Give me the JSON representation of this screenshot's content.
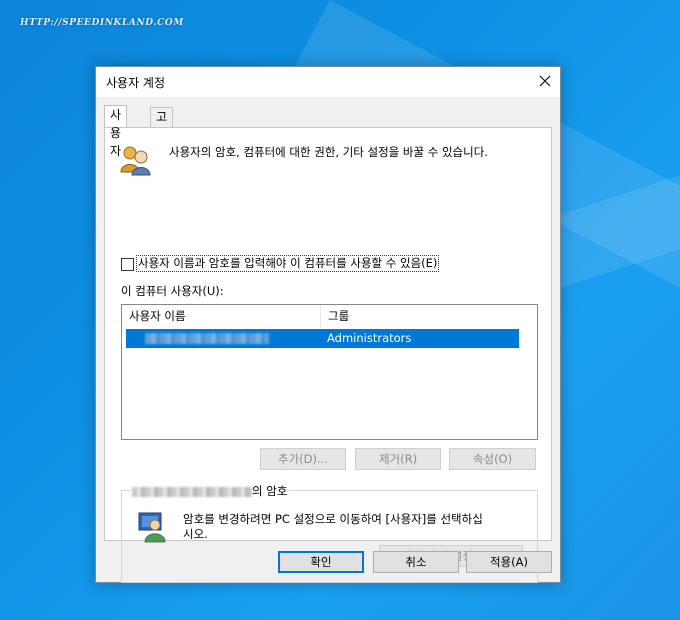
{
  "desktop": {
    "watermark": "HTTP://SPEEDINKLAND.COM"
  },
  "window": {
    "title": "사용자 계정",
    "close_glyph": "✕",
    "tabs": [
      {
        "label": "사용자",
        "active": true
      },
      {
        "label": "고급",
        "active": false
      }
    ],
    "intro_text": "사용자의 암호, 컴퓨터에 대한 권한, 기타 설정을 바꿀 수 있습니다.",
    "must_login_checkbox": {
      "label": "사용자 이름과 암호를 입력해야 이 컴퓨터를 사용할 수 있음(E)",
      "checked": false
    },
    "users_label": "이 컴퓨터 사용자(U):",
    "users_table": {
      "columns": [
        "사용자 이름",
        "그룹"
      ],
      "rows": [
        {
          "user_name": "",
          "group": "Administrators",
          "selected": true
        }
      ]
    },
    "buttons": {
      "add": "추가(D)...",
      "remove": "제거(R)",
      "properties": "속성(O)"
    },
    "password_group": {
      "title_suffix": "의 암호",
      "text_line1": "암호를 변경하려면 PC 설정으로 이동하여 [사용자]를 선택하십",
      "text_line2": "시오.",
      "reset_button": "암호 다시 설정(P)..."
    },
    "footer": {
      "ok": "확인",
      "cancel": "취소",
      "apply": "적용(A)"
    }
  },
  "colors": {
    "desktop_blue": "#0e8fe3",
    "selection": "#0078d7"
  }
}
